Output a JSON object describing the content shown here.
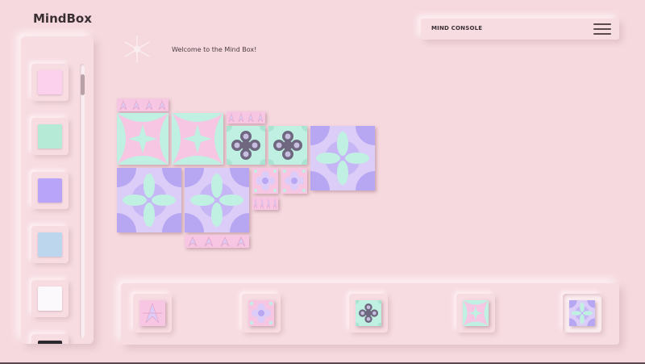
{
  "app": {
    "title": "MindBox",
    "welcome": "Welcome to the Mind Box!"
  },
  "console": {
    "label": "MIND CONSOLE",
    "menu_icon": "hamburger-menu-icon"
  },
  "palette": {
    "colors": [
      "#fcd1ee",
      "#b4ead6",
      "#b8a4f9",
      "#bcd6ee",
      "#fbf9fb",
      "#2c2830"
    ]
  },
  "tile_colors": {
    "pink": "#f6c6e2",
    "mint": "#bff0e2",
    "lilac": "#dccdf8",
    "violet": "#b7a7f3",
    "grey": "#6f6680"
  },
  "tray": {
    "patterns": [
      "arrows",
      "flower-pink",
      "beads",
      "star-mint",
      "clover"
    ],
    "selected_index": 4
  }
}
